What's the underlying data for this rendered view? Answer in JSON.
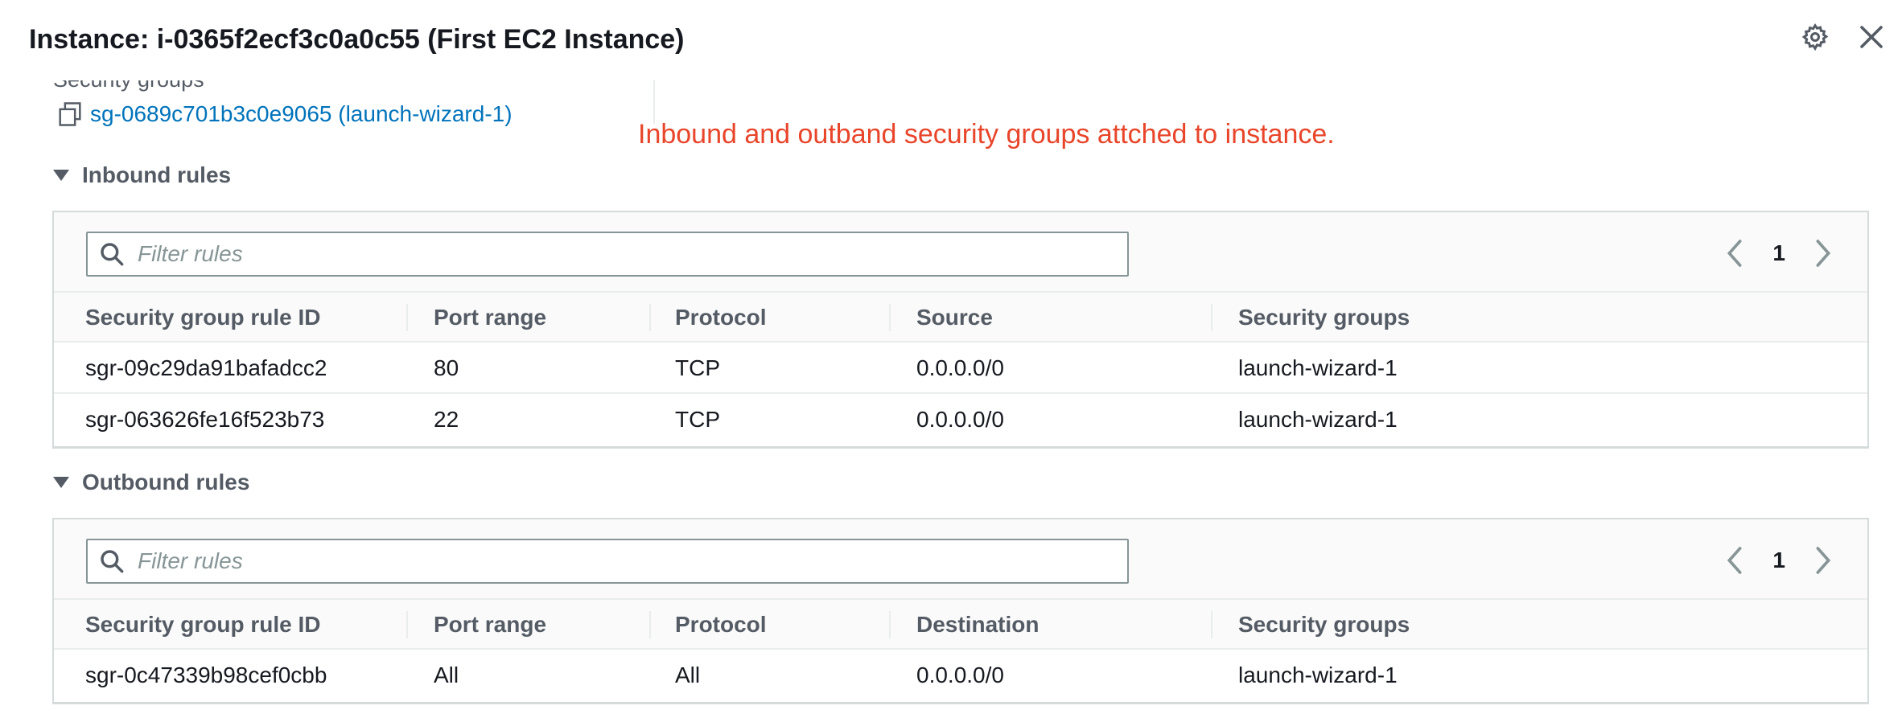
{
  "header": {
    "title": "Instance: i-0365f2ecf3c0a0c55 (First EC2 Instance)",
    "icons": [
      "gear-icon",
      "close-icon"
    ]
  },
  "security_groups_section": {
    "label": "Security groups",
    "link_text": "sg-0689c701b3c0e9065 (launch-wizard-1)",
    "link_color": "#0073bb"
  },
  "annotation": {
    "text": "Inbound and outband security groups attched to instance.",
    "color": "#e8452a"
  },
  "inbound": {
    "heading": "Inbound rules",
    "filter_placeholder": "Filter rules",
    "page": "1",
    "columns": [
      "Security group rule ID",
      "Port range",
      "Protocol",
      "Source",
      "Security groups"
    ],
    "rows": [
      [
        "sgr-09c29da91bafadcc2",
        "80",
        "TCP",
        "0.0.0.0/0",
        "launch-wizard-1"
      ],
      [
        "sgr-063626fe16f523b73",
        "22",
        "TCP",
        "0.0.0.0/0",
        "launch-wizard-1"
      ]
    ]
  },
  "outbound": {
    "heading": "Outbound rules",
    "filter_placeholder": "Filter rules",
    "page": "1",
    "columns": [
      "Security group rule ID",
      "Port range",
      "Protocol",
      "Destination",
      "Security groups"
    ],
    "rows": [
      [
        "sgr-0c47339b98cef0cbb",
        "All",
        "All",
        "0.0.0.0/0",
        "launch-wizard-1"
      ]
    ]
  }
}
